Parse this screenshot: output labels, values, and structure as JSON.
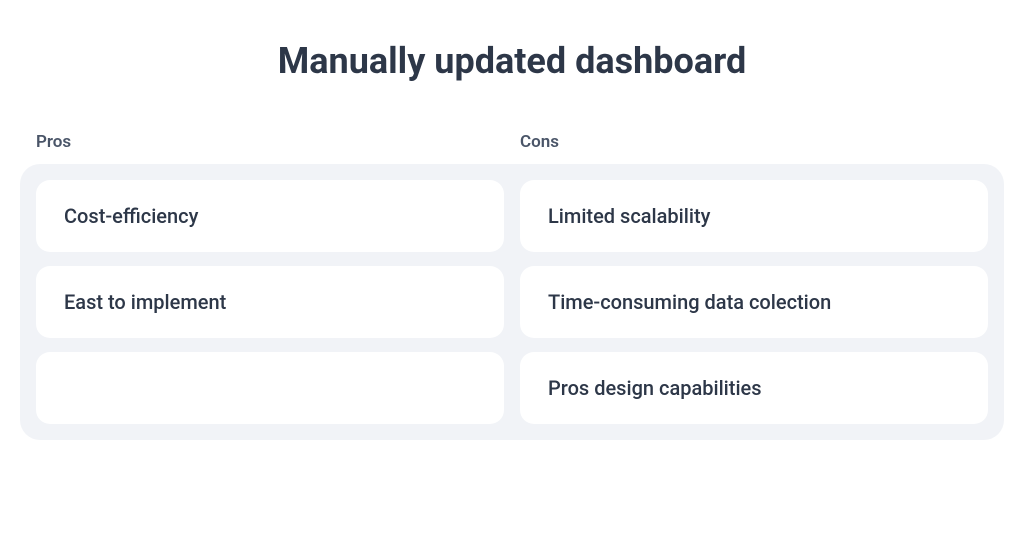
{
  "title": "Manually updated dashboard",
  "columns": {
    "pros_label": "Pros",
    "cons_label": "Cons"
  },
  "rows": [
    {
      "pro": "Cost-efficiency",
      "con": "Limited scalability"
    },
    {
      "pro": "East to implement",
      "con": "Time-consuming data colection"
    },
    {
      "pro": "",
      "con": "Pros design capabilities"
    }
  ]
}
